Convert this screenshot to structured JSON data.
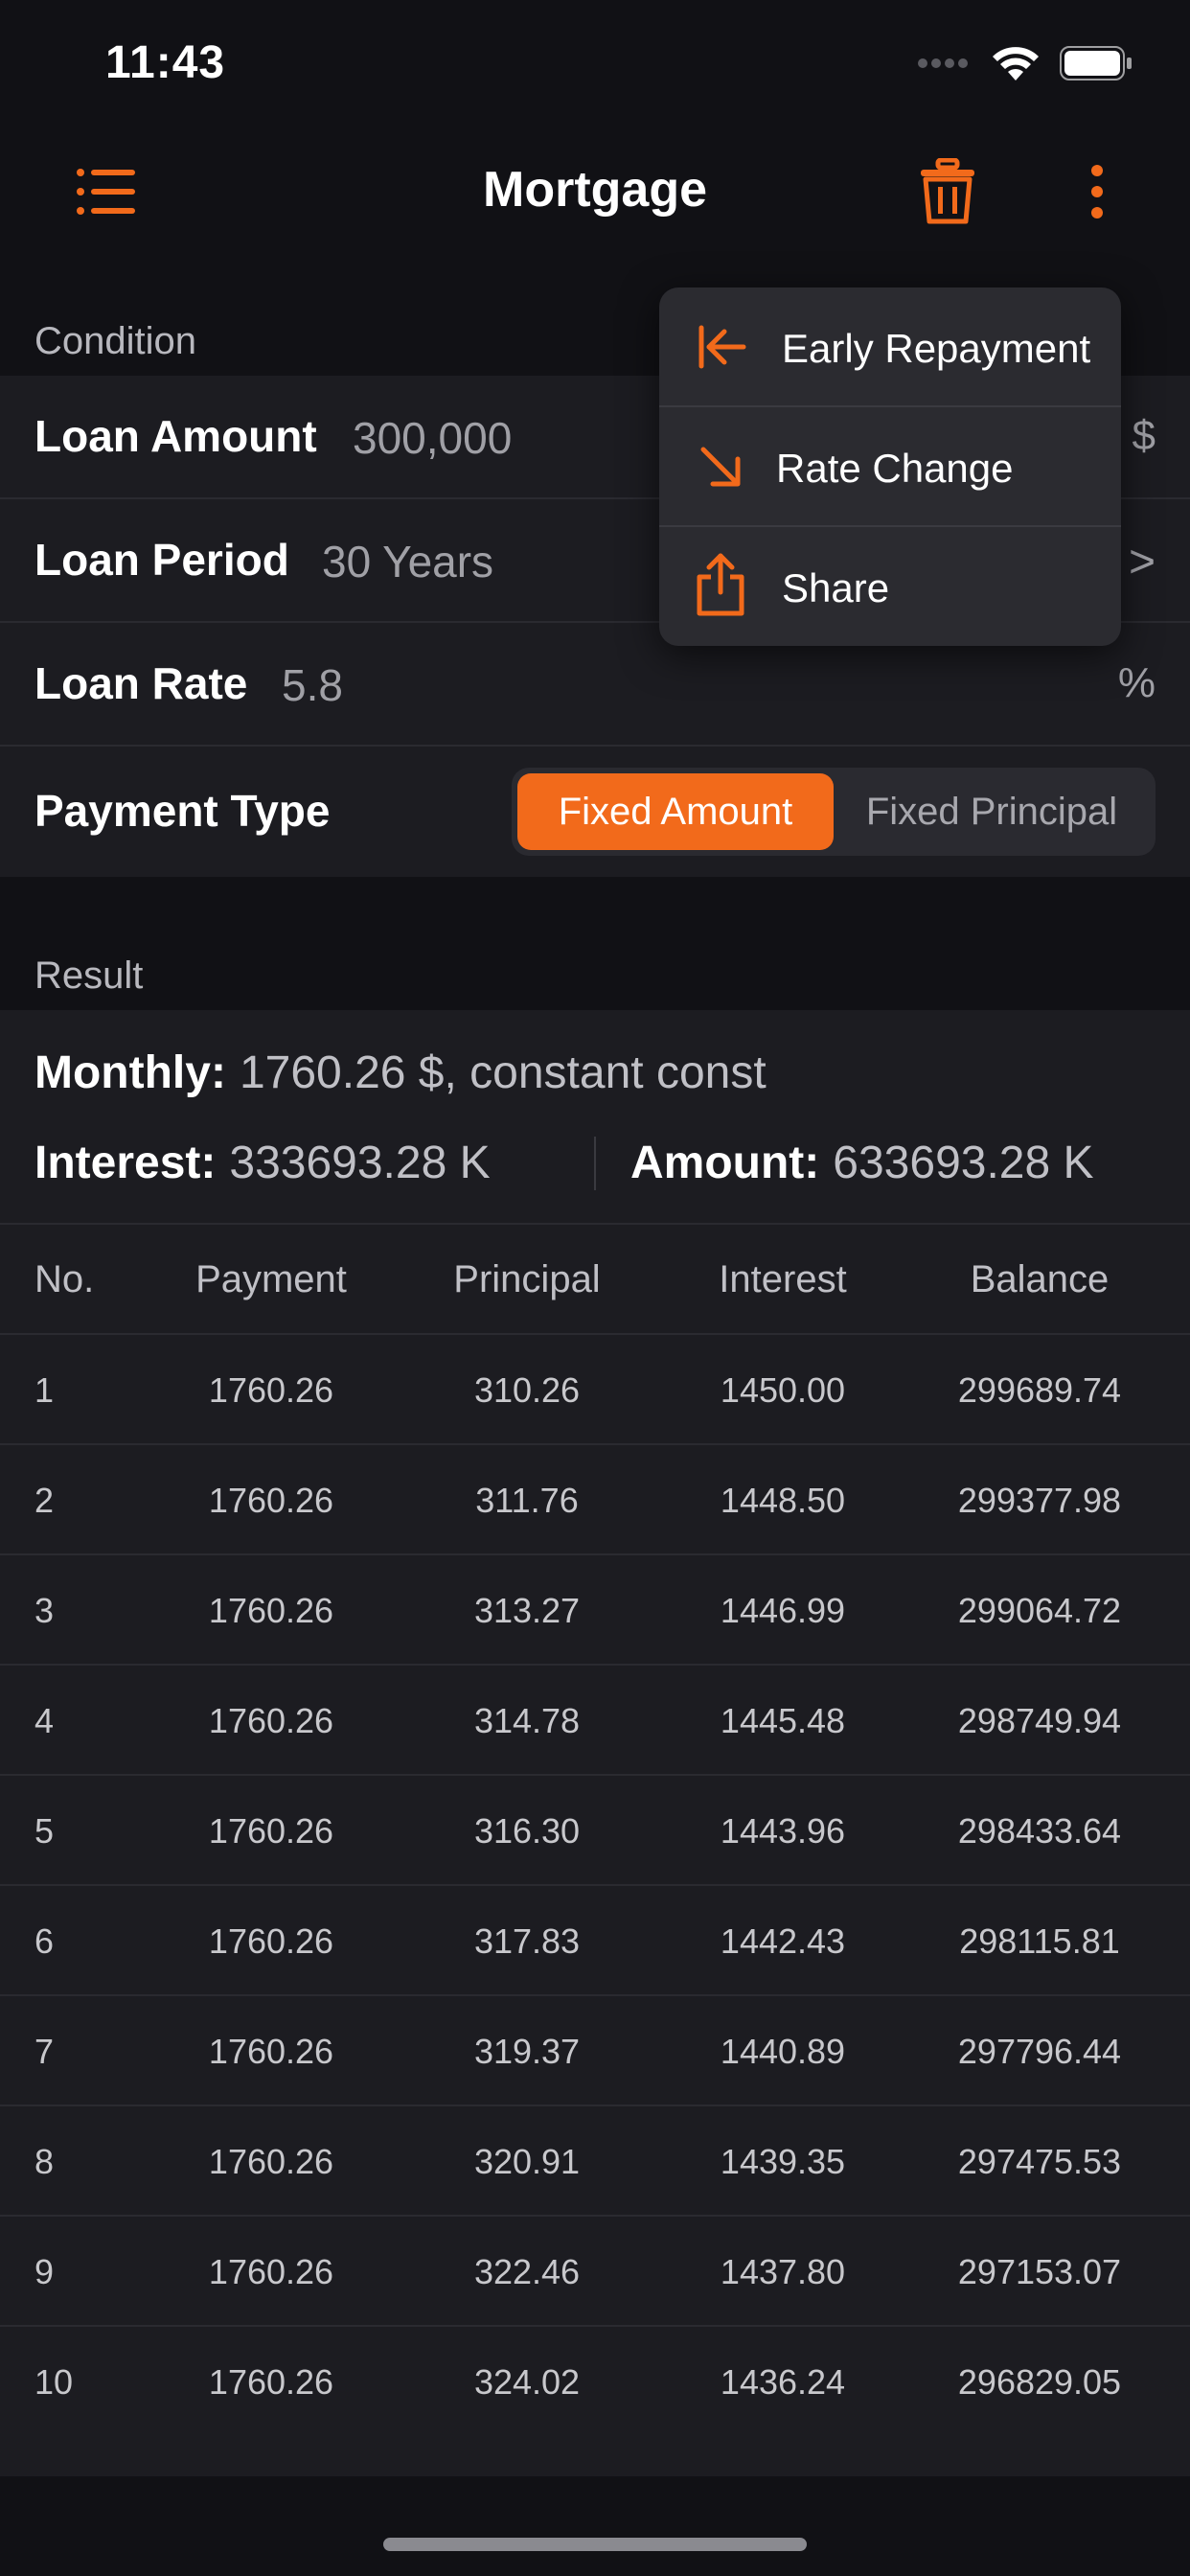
{
  "status": {
    "time": "11:43"
  },
  "nav": {
    "title": "Mortgage"
  },
  "colors": {
    "accent": "#f26a1b",
    "background": "#111115",
    "card": "#1c1c21"
  },
  "icons": {
    "menu": "list-icon",
    "delete": "trash-icon",
    "more": "more-vertical-icon"
  },
  "condition": {
    "header": "Condition",
    "loan_amount": {
      "label": "Loan Amount",
      "value": "300,000",
      "unit": "$"
    },
    "loan_period": {
      "label": "Loan Period",
      "value": "30 Years",
      "chevron": ">"
    },
    "loan_rate": {
      "label": "Loan Rate",
      "value": "5.8",
      "unit": "%"
    },
    "payment_type": {
      "label": "Payment Type",
      "options": [
        "Fixed Amount",
        "Fixed Principal"
      ],
      "selected": "Fixed Amount"
    }
  },
  "result": {
    "header": "Result",
    "monthly": {
      "label": "Monthly:",
      "value": "1760.26 $, constant const"
    },
    "interest": {
      "label": "Interest:",
      "value": "333693.28 K"
    },
    "amount": {
      "label": "Amount:",
      "value": "633693.28 K"
    }
  },
  "table": {
    "headers": [
      "No.",
      "Payment",
      "Principal",
      "Interest",
      "Balance"
    ],
    "rows": [
      [
        "1",
        "1760.26",
        "310.26",
        "1450.00",
        "299689.74"
      ],
      [
        "2",
        "1760.26",
        "311.76",
        "1448.50",
        "299377.98"
      ],
      [
        "3",
        "1760.26",
        "313.27",
        "1446.99",
        "299064.72"
      ],
      [
        "4",
        "1760.26",
        "314.78",
        "1445.48",
        "298749.94"
      ],
      [
        "5",
        "1760.26",
        "316.30",
        "1443.96",
        "298433.64"
      ],
      [
        "6",
        "1760.26",
        "317.83",
        "1442.43",
        "298115.81"
      ],
      [
        "7",
        "1760.26",
        "319.37",
        "1440.89",
        "297796.44"
      ],
      [
        "8",
        "1760.26",
        "320.91",
        "1439.35",
        "297475.53"
      ],
      [
        "9",
        "1760.26",
        "322.46",
        "1437.80",
        "297153.07"
      ],
      [
        "10",
        "1760.26",
        "324.02",
        "1436.24",
        "296829.05"
      ]
    ]
  },
  "menu": {
    "items": [
      {
        "label": "Early Repayment",
        "icon": "arrow-left-to-line-icon"
      },
      {
        "label": "Rate Change",
        "icon": "arrow-down-right-icon"
      },
      {
        "label": "Share",
        "icon": "share-icon"
      }
    ]
  }
}
